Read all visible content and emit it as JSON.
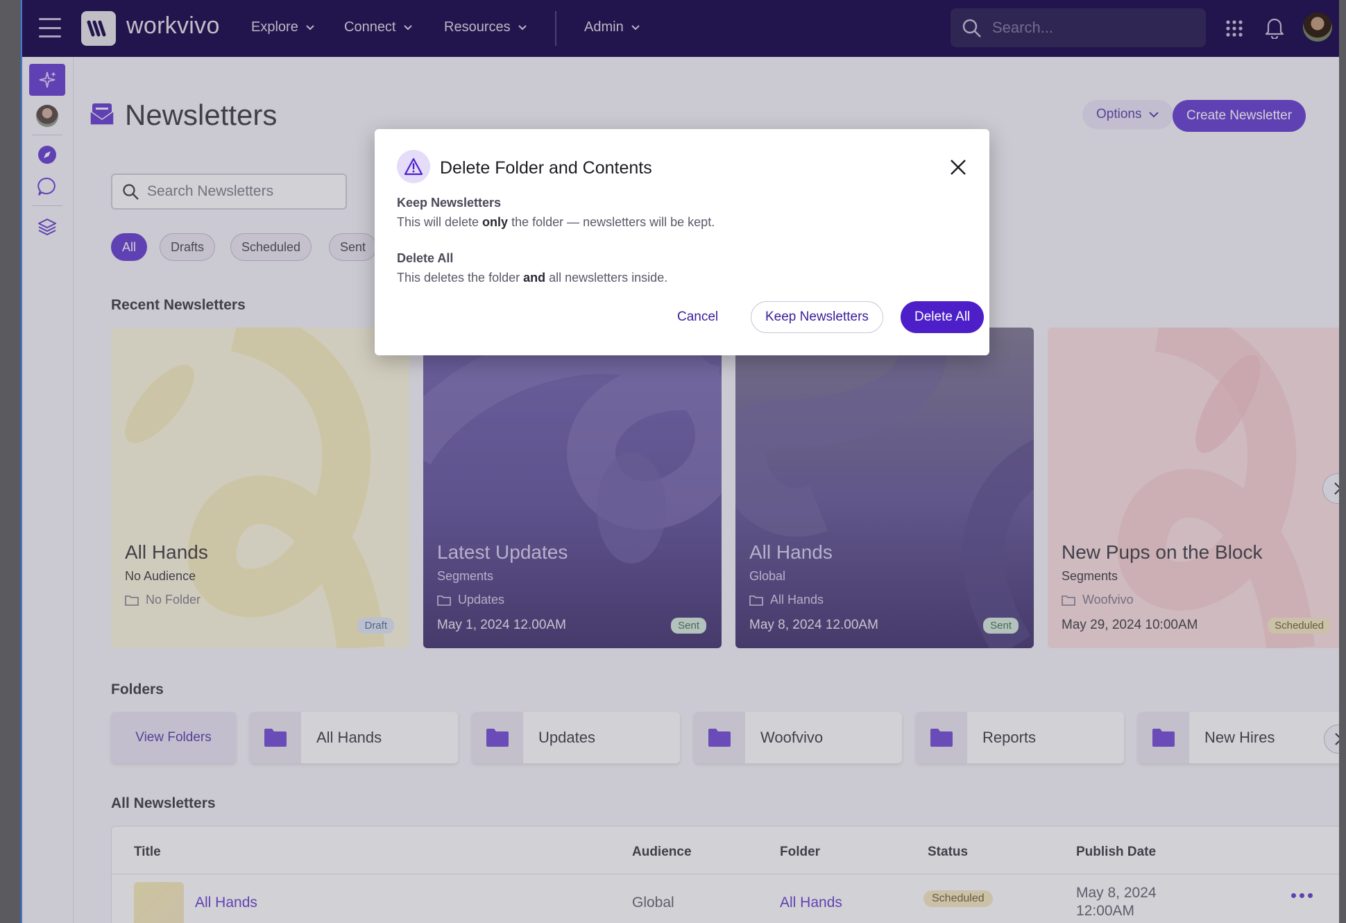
{
  "app": {
    "logo_text": "workvivo"
  },
  "nav": {
    "explore": "Explore",
    "connect": "Connect",
    "resources": "Resources",
    "admin": "Admin"
  },
  "search": {
    "placeholder": "Search..."
  },
  "page": {
    "title": "Newsletters",
    "options_label": "Options",
    "create_label": "Create Newsletter",
    "search_placeholder": "Search Newsletters"
  },
  "filters": [
    "All",
    "Drafts",
    "Scheduled",
    "Sent"
  ],
  "sections": {
    "recent": "Recent Newsletters",
    "folders": "Folders",
    "all": "All Newsletters"
  },
  "cards": [
    {
      "title": "All Hands",
      "audience": "No Audience",
      "folder": "No Folder",
      "date": "",
      "status": "Draft"
    },
    {
      "title": "Latest Updates",
      "audience": "Segments",
      "folder": "Updates",
      "date": "May 1, 2024 12.00AM",
      "status": "Sent"
    },
    {
      "title": "All Hands",
      "audience": "Global",
      "folder": "All Hands",
      "date": "May 8, 2024 12.00AM",
      "status": "Sent"
    },
    {
      "title": "New Pups on the Block",
      "audience": "Segments",
      "folder": "Woofvivo",
      "date": "May 29, 2024 10:00AM",
      "status": "Scheduled"
    }
  ],
  "folders": {
    "view_label": "View Folders",
    "items": [
      "All Hands",
      "Updates",
      "Woofvivo",
      "Reports",
      "New Hires"
    ]
  },
  "table": {
    "headers": {
      "title": "Title",
      "audience": "Audience",
      "folder": "Folder",
      "status": "Status",
      "publish_date": "Publish Date"
    },
    "rows": [
      {
        "title": "All Hands",
        "audience": "Global",
        "folder": "All Hands",
        "status": "Scheduled",
        "date_line1": "May 8, 2024",
        "date_line2": "12:00AM"
      }
    ]
  },
  "modal": {
    "title": "Delete Folder and Contents",
    "keep_heading": "Keep Newsletters",
    "keep_text_1": "This will delete ",
    "keep_text_bold": "only",
    "keep_text_2": " the folder — newsletters will be kept.",
    "delete_heading": "Delete All",
    "delete_text_1": "This deletes the folder ",
    "delete_text_bold": "and",
    "delete_text_2": " all newsletters inside.",
    "cancel_label": "Cancel",
    "keep_label": "Keep Newsletters",
    "delete_label": "Delete All"
  },
  "colors": {
    "nav_bg": "#2a1a5e",
    "accent": "#4d1fc9"
  }
}
